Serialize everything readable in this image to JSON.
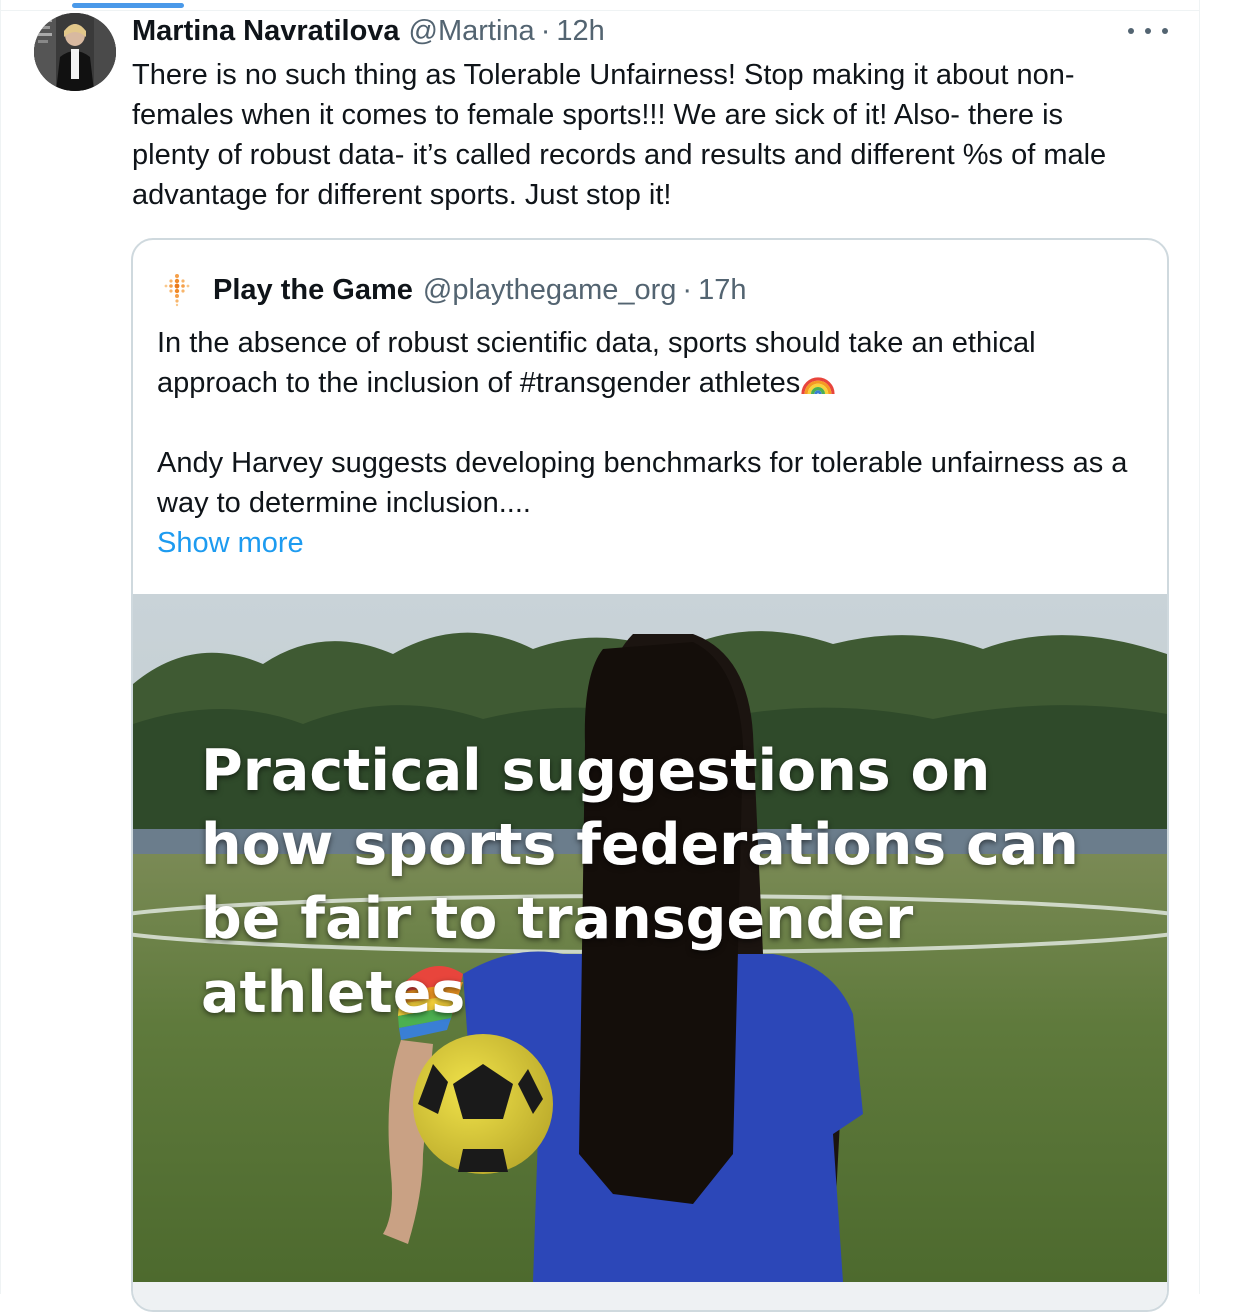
{
  "tweet": {
    "author_name": "Martina Navratilova",
    "author_handle": "@Martina",
    "separator": "·",
    "time": "12h",
    "text": "There is no such thing as Tolerable Unfairness! Stop making it about non-females when it comes to female sports!!! We are sick of it! Also- there is plenty of robust data- it’s called records and results and different %s of male advantage for different sports. Just stop it!"
  },
  "quote": {
    "author_name": "Play the Game",
    "author_handle": "@playthegame_org",
    "separator": "·",
    "time": "17h",
    "paragraph1": "In the absence of robust scientific data, sports should take an ethical approach to the inclusion of #transgender athletes",
    "paragraph2": "Andy Harvey suggests developing benchmarks for tolerable unfairness as a way to determine inclusion....",
    "show_more": "Show more",
    "image_headline": "Practical suggestions on how sports federations can be fair to transgender athletes"
  },
  "icons": {
    "more": "more-horizontal-icon",
    "rainbow": "rainbow-emoji-icon",
    "logo": "play-the-game-logo-icon"
  },
  "colors": {
    "link": "#1d9bf0",
    "secondary_text": "#536471",
    "border": "#cfd9de"
  }
}
